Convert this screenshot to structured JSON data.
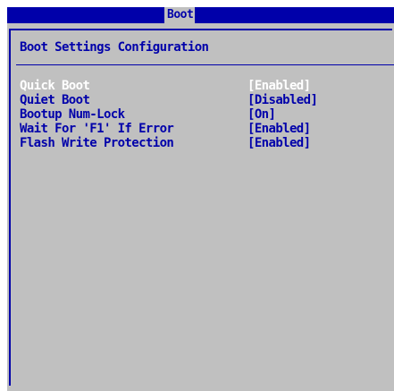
{
  "window": {
    "tab_label": "Boot"
  },
  "section": {
    "title": "Boot Settings Configuration"
  },
  "settings": [
    {
      "name": "Quick Boot",
      "value": "[Enabled]",
      "selected": true
    },
    {
      "name": "Quiet Boot",
      "value": "[Disabled]",
      "selected": false
    },
    {
      "name": "Bootup Num-Lock",
      "value": "[On]",
      "selected": false
    },
    {
      "name": "Wait For 'F1' If Error",
      "value": "[Enabled]",
      "selected": false
    },
    {
      "name": "Flash Write Protection",
      "value": "[Enabled]",
      "selected": false
    }
  ],
  "colors": {
    "title_bar": "#0000aa",
    "panel": "#c0c0c0",
    "text": "#0000aa",
    "selected_text": "#ffffff"
  }
}
